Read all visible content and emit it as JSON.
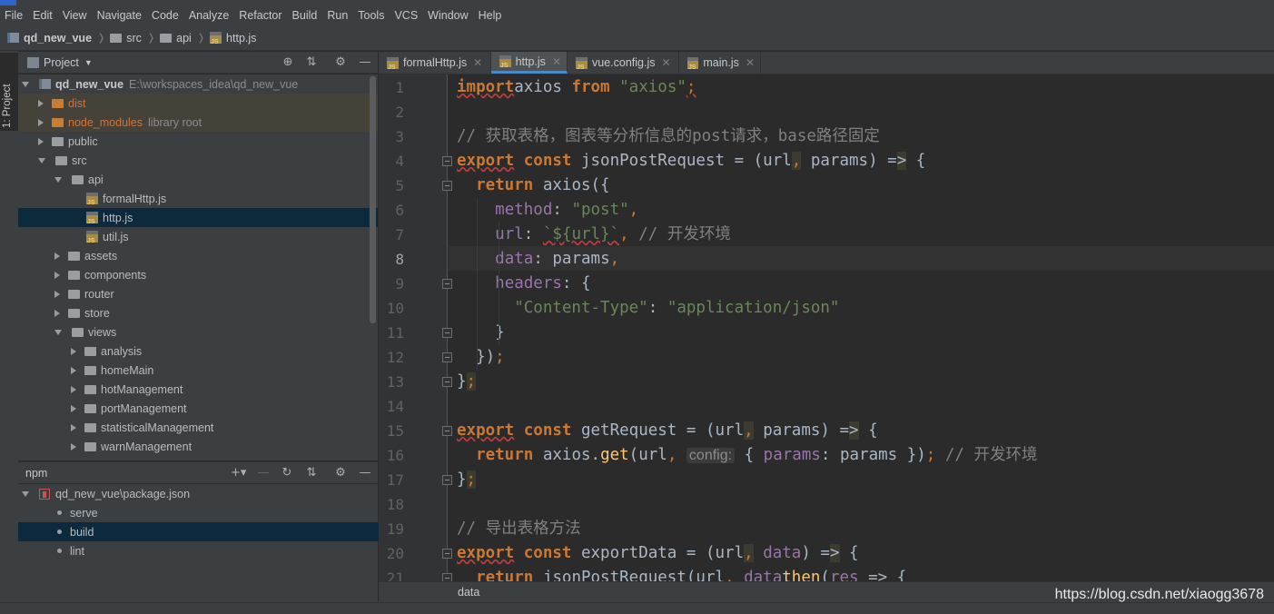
{
  "menu": [
    "File",
    "Edit",
    "View",
    "Navigate",
    "Code",
    "Analyze",
    "Refactor",
    "Build",
    "Run",
    "Tools",
    "VCS",
    "Window",
    "Help"
  ],
  "breadcrumb": [
    "qd_new_vue",
    "src",
    "api",
    "http.js"
  ],
  "left_stripe": {
    "project_tab": "1: Project"
  },
  "project_panel": {
    "title": "Project",
    "tree": [
      {
        "label": "qd_new_vue",
        "extra": "E:\\workspaces_idea\\qd_new_vue",
        "depth": 0,
        "expanded": true,
        "icon": "project-icon",
        "bold": true
      },
      {
        "label": "dist",
        "depth": 1,
        "expanded": false,
        "icon": "folder-orange-icon",
        "excluded": true
      },
      {
        "label": "node_modules",
        "extra": "library root",
        "depth": 1,
        "expanded": false,
        "icon": "folder-orange-icon",
        "excluded": true
      },
      {
        "label": "public",
        "depth": 1,
        "expanded": false,
        "icon": "folder-icon"
      },
      {
        "label": "src",
        "depth": 1,
        "expanded": true,
        "icon": "folder-icon"
      },
      {
        "label": "api",
        "depth": 2,
        "expanded": true,
        "icon": "folder-icon"
      },
      {
        "label": "formalHttp.js",
        "depth": 3,
        "icon": "js-file-icon"
      },
      {
        "label": "http.js",
        "depth": 3,
        "icon": "js-file-icon",
        "selected": true
      },
      {
        "label": "util.js",
        "depth": 3,
        "icon": "js-file-icon"
      },
      {
        "label": "assets",
        "depth": 2,
        "expanded": false,
        "icon": "folder-icon"
      },
      {
        "label": "components",
        "depth": 2,
        "expanded": false,
        "icon": "folder-icon"
      },
      {
        "label": "router",
        "depth": 2,
        "expanded": false,
        "icon": "folder-icon"
      },
      {
        "label": "store",
        "depth": 2,
        "expanded": false,
        "icon": "folder-icon"
      },
      {
        "label": "views",
        "depth": 2,
        "expanded": true,
        "icon": "folder-icon"
      },
      {
        "label": "analysis",
        "depth": 3,
        "expanded": false,
        "icon": "folder-icon"
      },
      {
        "label": "homeMain",
        "depth": 3,
        "expanded": false,
        "icon": "folder-icon"
      },
      {
        "label": "hotManagement",
        "depth": 3,
        "expanded": false,
        "icon": "folder-icon"
      },
      {
        "label": "portManagement",
        "depth": 3,
        "expanded": false,
        "icon": "folder-icon"
      },
      {
        "label": "statisticalManagement",
        "depth": 3,
        "expanded": false,
        "icon": "folder-icon"
      },
      {
        "label": "warnManagement",
        "depth": 3,
        "expanded": false,
        "icon": "folder-icon"
      }
    ]
  },
  "npm_panel": {
    "title": "npm",
    "package": "qd_new_vue\\package.json",
    "scripts": [
      {
        "label": "serve"
      },
      {
        "label": "build",
        "selected": true
      },
      {
        "label": "lint"
      }
    ]
  },
  "tabs": [
    {
      "label": "formalHttp.js",
      "active": false
    },
    {
      "label": "http.js",
      "active": true
    },
    {
      "label": "vue.config.js",
      "active": false
    },
    {
      "label": "main.js",
      "active": false
    }
  ],
  "editor": {
    "current_line": 8,
    "lines": [
      {
        "n": "1",
        "tokens": [
          [
            "kw sq",
            "import"
          ],
          [
            "",
            "axios "
          ],
          [
            "kw",
            "from"
          ],
          [
            "",
            " "
          ],
          [
            "str",
            "\"axios\""
          ],
          [
            "punc sq",
            ";"
          ]
        ]
      },
      {
        "n": "2",
        "tokens": []
      },
      {
        "n": "3",
        "tokens": [
          [
            "cm",
            "// 获取表格，图表等分析信息的post请求，base路径固定"
          ]
        ]
      },
      {
        "n": "4",
        "tokens": [
          [
            "kw sq",
            "export"
          ],
          [
            "",
            " "
          ],
          [
            "kw",
            "const"
          ],
          [
            "",
            " jsonPostRequest = (url"
          ],
          [
            "punc hl",
            ","
          ],
          [
            "",
            " params) "
          ],
          [
            "",
            "="
          ],
          [
            "hl",
            ">"
          ],
          [
            "",
            " {"
          ]
        ]
      },
      {
        "n": "5",
        "tokens": [
          [
            "",
            "  "
          ],
          [
            "kw",
            "return"
          ],
          [
            "",
            " axios({"
          ]
        ]
      },
      {
        "n": "6",
        "tokens": [
          [
            "",
            "    "
          ],
          [
            "prop",
            "method"
          ],
          [
            "",
            ": "
          ],
          [
            "str",
            "\"post\""
          ],
          [
            "punc",
            ","
          ]
        ]
      },
      {
        "n": "7",
        "tokens": [
          [
            "",
            "    "
          ],
          [
            "prop",
            "url"
          ],
          [
            "",
            ": "
          ],
          [
            "str sq",
            "`${url}`"
          ],
          [
            "punc",
            ","
          ],
          [
            "",
            " "
          ],
          [
            "cm",
            "// 开发环境"
          ]
        ]
      },
      {
        "n": "8",
        "tokens": [
          [
            "",
            "    "
          ],
          [
            "prop",
            "data"
          ],
          [
            "",
            ": params"
          ],
          [
            "punc",
            ","
          ]
        ]
      },
      {
        "n": "9",
        "tokens": [
          [
            "",
            "    "
          ],
          [
            "prop",
            "headers"
          ],
          [
            "",
            ": {"
          ]
        ]
      },
      {
        "n": "10",
        "tokens": [
          [
            "",
            "      "
          ],
          [
            "str",
            "\"Content-Type\""
          ],
          [
            "",
            ": "
          ],
          [
            "str",
            "\"application/json\""
          ]
        ]
      },
      {
        "n": "11",
        "tokens": [
          [
            "",
            "    }"
          ]
        ]
      },
      {
        "n": "12",
        "tokens": [
          [
            "",
            "  })"
          ],
          [
            "punc",
            ";"
          ]
        ]
      },
      {
        "n": "13",
        "tokens": [
          [
            "",
            "}"
          ],
          [
            "punc hl",
            ";"
          ]
        ]
      },
      {
        "n": "14",
        "tokens": []
      },
      {
        "n": "15",
        "tokens": [
          [
            "kw sq",
            "export"
          ],
          [
            "",
            " "
          ],
          [
            "kw",
            "const"
          ],
          [
            "",
            " getRequest = (url"
          ],
          [
            "punc hl",
            ","
          ],
          [
            "",
            " params) ="
          ],
          [
            "hl",
            ">"
          ],
          [
            "",
            " {"
          ]
        ]
      },
      {
        "n": "16",
        "tokens": [
          [
            "",
            "  "
          ],
          [
            "kw",
            "return"
          ],
          [
            "",
            " axios."
          ],
          [
            "fn",
            "get"
          ],
          [
            "",
            "(url"
          ],
          [
            "punc",
            ","
          ],
          [
            "",
            " "
          ],
          [
            "hint",
            "config:"
          ],
          [
            "",
            " { "
          ],
          [
            "prop",
            "params"
          ],
          [
            "",
            ": params })"
          ],
          [
            "punc",
            ";"
          ],
          [
            "",
            " "
          ],
          [
            "cm",
            "// 开发环境"
          ]
        ]
      },
      {
        "n": "17",
        "tokens": [
          [
            "",
            "}"
          ],
          [
            "punc hl",
            ";"
          ]
        ]
      },
      {
        "n": "18",
        "tokens": []
      },
      {
        "n": "19",
        "tokens": [
          [
            "cm",
            "// 导出表格方法"
          ]
        ]
      },
      {
        "n": "20",
        "tokens": [
          [
            "kw sq",
            "export"
          ],
          [
            "",
            " "
          ],
          [
            "kw",
            "const"
          ],
          [
            "",
            " exportData = (url"
          ],
          [
            "punc hl",
            ","
          ],
          [
            "",
            " "
          ],
          [
            "prop",
            "data"
          ],
          [
            "",
            ") ="
          ],
          [
            "hl",
            ">"
          ],
          [
            "",
            " {"
          ]
        ]
      },
      {
        "n": "21",
        "tokens": [
          [
            "",
            "  "
          ],
          [
            "kw",
            "return"
          ],
          [
            "",
            " jsonPostRequest(url"
          ],
          [
            "punc",
            ","
          ],
          [
            "",
            " "
          ],
          [
            "prop",
            "data"
          ],
          [
            ")."
          ],
          [
            "fn",
            "then"
          ],
          [
            "",
            "("
          ],
          [
            "prop",
            "res"
          ],
          [
            "",
            " => {"
          ]
        ]
      }
    ]
  },
  "status_bar": {
    "breadcrumb": "data"
  },
  "watermark": "https://blog.csdn.net/xiaogg3678",
  "colors": {
    "keyword": "#cc7832",
    "string": "#6a8759",
    "comment": "#808080",
    "property": "#9876aa",
    "selection": "#0d293e",
    "accent": "#4a88c7"
  }
}
